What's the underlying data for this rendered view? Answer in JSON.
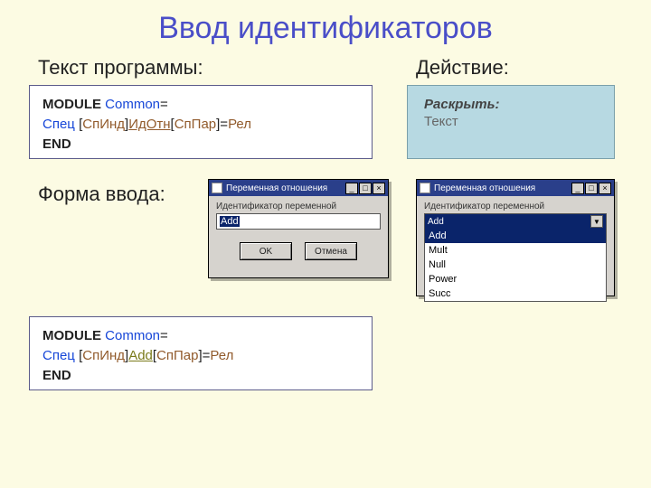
{
  "title": "Ввод идентификаторов",
  "labels": {
    "program": "Текст программы:",
    "action": "Действие:",
    "form": "Форма ввода:"
  },
  "code1": {
    "kw_module": "MODULE ",
    "common": "Common",
    "eq": "=",
    "indent": "  ",
    "spec": "Спец ",
    "lbr1": "[",
    "spind": "СпИнд",
    "rbr1": "]",
    "idotn": "ИдОтн",
    "lbr2": "[",
    "sppar": "СпПар",
    "rbr2": "]=",
    "rel": "Рел",
    "end": "END"
  },
  "code2": {
    "kw_module": "MODULE ",
    "common": "Common",
    "eq": "=",
    "indent": "  ",
    "spec": "Спец ",
    "lbr1": "[",
    "spind": "СпИнд",
    "rbr1": "]",
    "add": "Add",
    "lbr2": "[",
    "sppar": "СпПар",
    "rbr2": "]=",
    "rel": "Рел",
    "end": "END"
  },
  "action_box": {
    "header": "Раскрыть",
    "colon": ":",
    "sub": "Текст"
  },
  "dialog": {
    "title": "Переменная отношения",
    "field_label": "Идентификатор переменной",
    "value": "Add",
    "ok": "OK",
    "cancel": "Отмена",
    "options": [
      "Add",
      "Mult",
      "Null",
      "Power",
      "Succ"
    ]
  },
  "winbtns": {
    "min": "_",
    "max": "□",
    "close": "×"
  }
}
